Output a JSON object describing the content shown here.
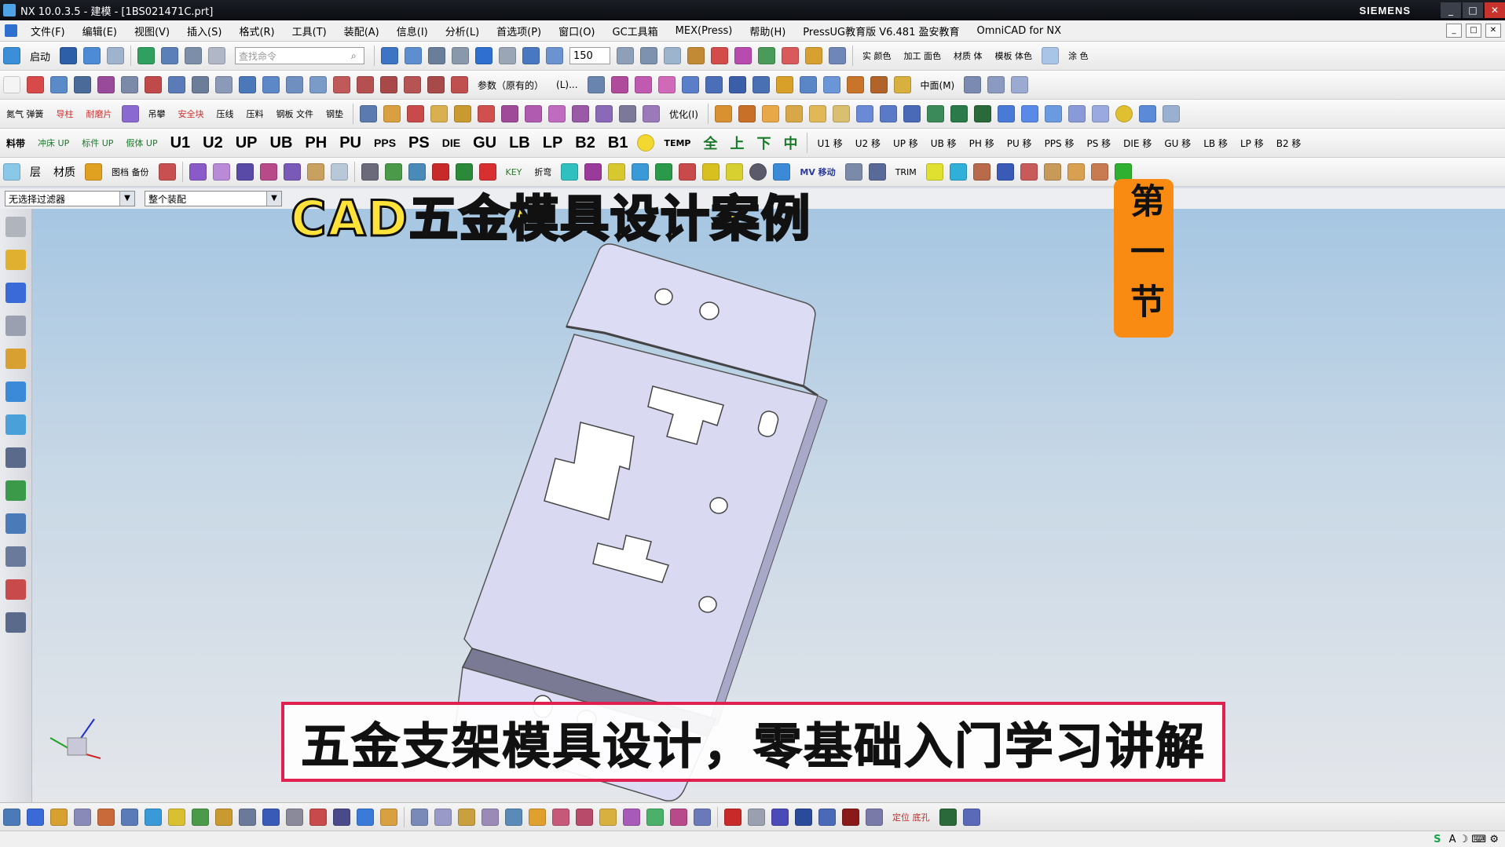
{
  "window": {
    "title": "NX 10.0.3.5 - 建模 - [1BS021471C.prt]",
    "brand": "SIEMENS",
    "controls": {
      "minimize": "_",
      "maximize": "□",
      "close": "✕"
    }
  },
  "menu": {
    "items": [
      "文件(F)",
      "编辑(E)",
      "视图(V)",
      "插入(S)",
      "格式(R)",
      "工具(T)",
      "装配(A)",
      "信息(I)",
      "分析(L)",
      "首选项(P)",
      "窗口(O)",
      "GC工具箱",
      "MEX(Press)",
      "帮助(H)",
      "PressUG教育版 V6.481 盈安教育",
      "OmniCAD for NX"
    ]
  },
  "toolbar1": {
    "start_label": "启动",
    "search_placeholder": "查找命令",
    "zoom_value": "150",
    "right_labels": [
      "实 颜色",
      "加工 面色",
      "材质 体",
      "模板 体色",
      "涂 色"
    ]
  },
  "toolbar2": {
    "param_label": "参数（原有的）",
    "param_short": "(L)...",
    "mid_label": "中面(M)"
  },
  "toolbar3": {
    "left_labels": [
      "氮气 弹簧",
      "导柱",
      "耐磨片",
      "",
      "吊攀",
      "安全块",
      "压线",
      "压料",
      "钢板 文件",
      "钢垫"
    ],
    "opt_label": "优化(I)"
  },
  "toolbar4": {
    "left_labels": [
      "料带",
      "冲床 UP",
      "标件 UP",
      "假体 UP"
    ],
    "plates": [
      "U1",
      "U2",
      "UP",
      "UB",
      "PH",
      "PU",
      "PPS",
      "PS",
      "DIE",
      "GU",
      "LB",
      "LP",
      "B2",
      "B1"
    ],
    "temp_label": "TEMP",
    "cn_labels": [
      "全",
      "上",
      "下",
      "中"
    ],
    "plates_move": [
      "U1 移",
      "U2 移",
      "UP 移",
      "UB 移",
      "PH 移",
      "PU 移",
      "PPS 移",
      "PS 移",
      "DIE 移",
      "GU 移",
      "LB 移",
      "LP 移",
      "B2 移"
    ]
  },
  "toolbar5": {
    "labels": [
      "层",
      "材质",
      "图档 备份"
    ],
    "key_label": "KEY",
    "fold_label": "折弯",
    "mv_label": "MV 移动",
    "trim_label": "TRIM"
  },
  "filters": {
    "selection_filter": "无选择过滤器",
    "scope": "整个装配"
  },
  "overlay": {
    "headline": "CAD五金模具设计案例",
    "badge": "第一节",
    "subtitle": "五金支架模具设计，零基础入门学习讲解"
  },
  "bottom_toolbar": {
    "labels": [
      "定位 底孔"
    ]
  },
  "status": {
    "tray_logo": "S",
    "tray_text": "A ☽ ⌨ ⚙"
  },
  "colors": {
    "viewport_top": "#a6c6e2",
    "part_fill": "#dcdcf4",
    "headline": "#ffe23a",
    "badge": "#f98b12",
    "subtitle_border": "#e0204f"
  }
}
